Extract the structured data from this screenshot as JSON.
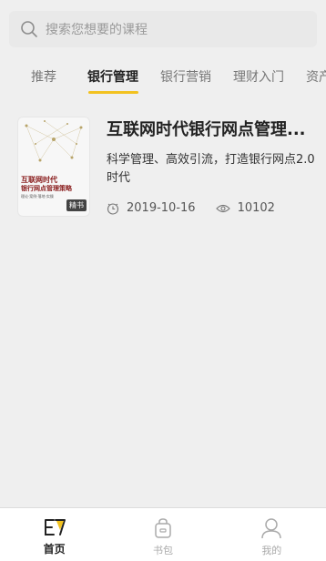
{
  "search": {
    "placeholder": "搜索您想要的课程"
  },
  "tabs": [
    {
      "label": "推荐",
      "active": false
    },
    {
      "label": "银行管理",
      "active": true
    },
    {
      "label": "银行营销",
      "active": false
    },
    {
      "label": "理财入门",
      "active": false
    },
    {
      "label": "资产",
      "active": false
    }
  ],
  "course": {
    "title": "互联网时代银行网点管理...",
    "description": "科学管理、高效引流，打造银行网点2.0时代",
    "date": "2019-10-16",
    "views": "10102",
    "cover": {
      "title_line1": "互联网时代",
      "title_line2": "银行网点管理策略",
      "subtitle": "理论·案例·落地·实操",
      "badge": "精书"
    }
  },
  "bottom_nav": [
    {
      "label": "首页",
      "icon": "home-icon",
      "active": true
    },
    {
      "label": "书包",
      "icon": "bag-icon",
      "active": false
    },
    {
      "label": "我的",
      "icon": "profile-icon",
      "active": false
    }
  ],
  "colors": {
    "accent": "#f2c21f",
    "background": "#efefef"
  }
}
